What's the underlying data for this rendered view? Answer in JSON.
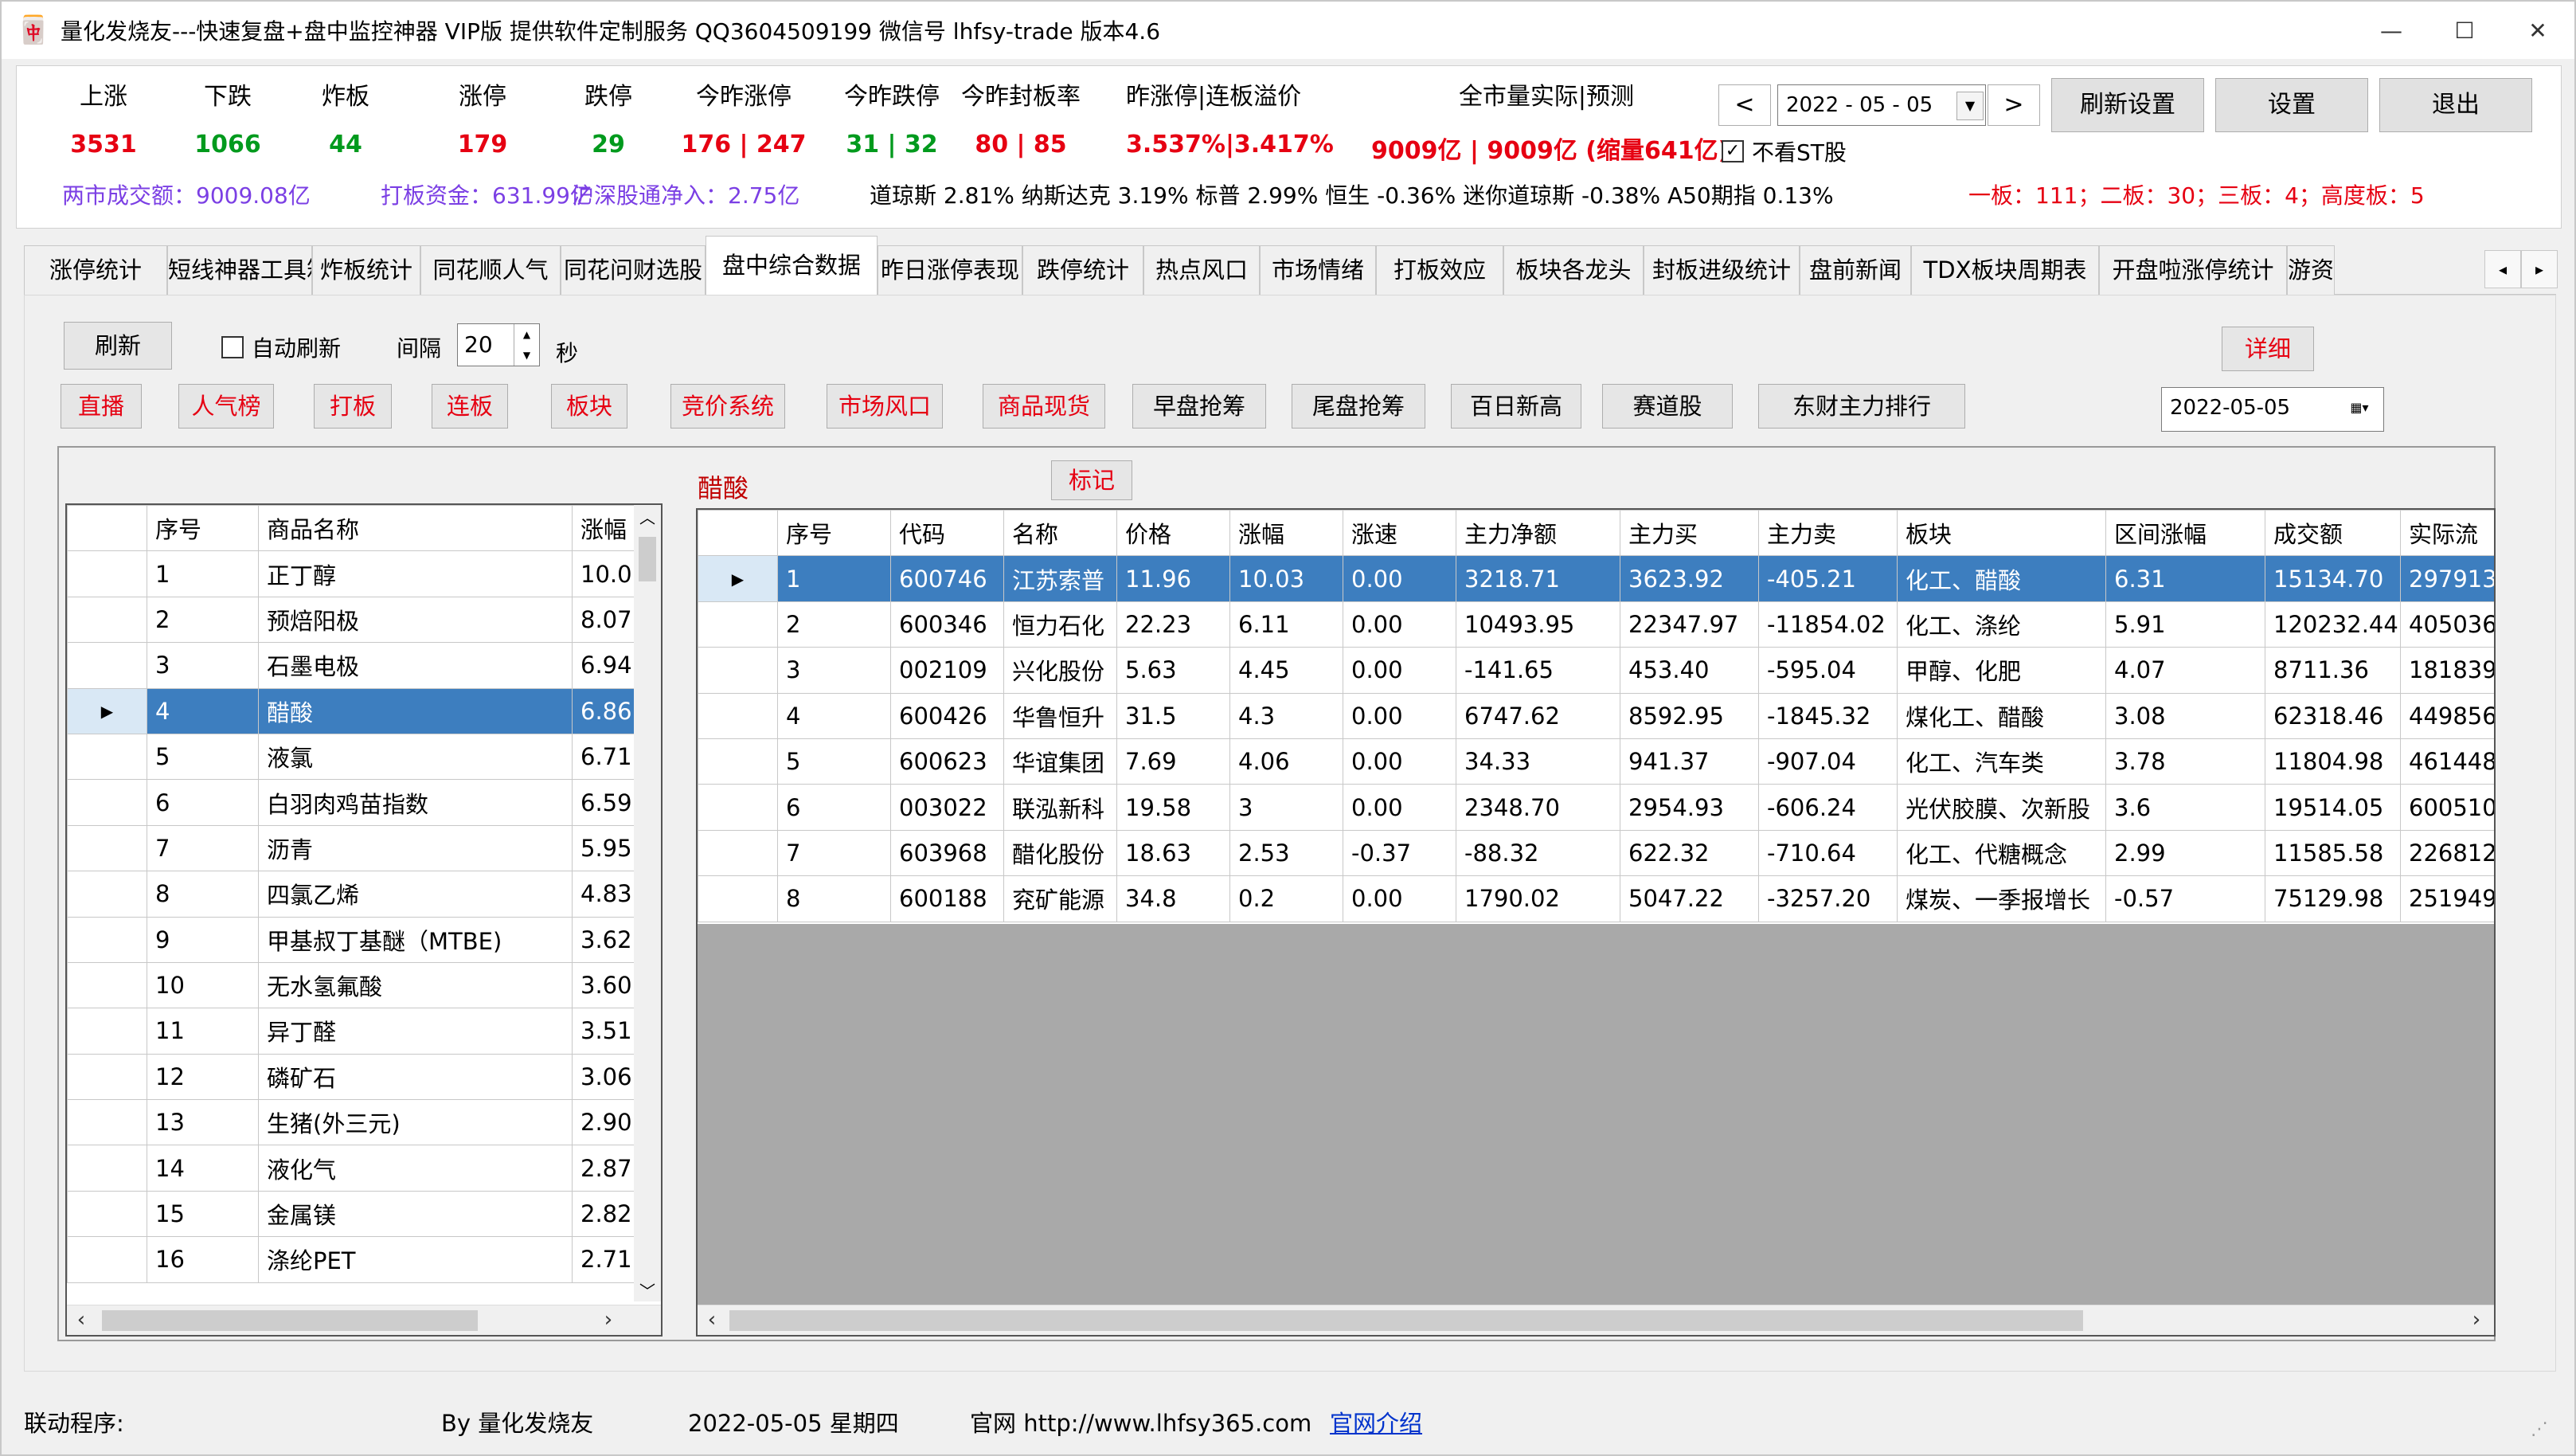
{
  "window": {
    "title": "量化发烧友---快速复盘+盘中监控神器 VIP版  提供软件定制服务 QQ3604509199 微信号 lhfsy-trade   版本4.6",
    "minimize": "—",
    "maximize": "☐",
    "close": "✕"
  },
  "stats": [
    {
      "label": "上涨",
      "value": "3531",
      "color": "red"
    },
    {
      "label": "下跌",
      "value": "1066",
      "color": "green"
    },
    {
      "label": "炸板",
      "value": "44",
      "color": "green"
    },
    {
      "label": "涨停",
      "value": "179",
      "color": "red"
    },
    {
      "label": "跌停",
      "value": "29",
      "color": "green"
    },
    {
      "label": "今昨涨停",
      "value": "176 | 247",
      "color": "red"
    },
    {
      "label": "今昨跌停",
      "value": "31 | 32",
      "color": "green"
    },
    {
      "label": "今昨封板率",
      "value": "80 | 85",
      "color": "red"
    },
    {
      "label": "昨涨停|连板溢价",
      "value": "3.537%|3.417%",
      "color": "red"
    },
    {
      "label": "全市量实际|预测",
      "value": "9009亿 | 9009亿 (缩量641亿)",
      "color": "red"
    }
  ],
  "date_picker": {
    "prev": "<",
    "value": "2022 - 05 - 05",
    "next": ">"
  },
  "buttons": {
    "refresh_settings": "刷新设置",
    "settings": "设置",
    "exit": "退出"
  },
  "hide_st": {
    "label": "不看ST股",
    "checked": "✓"
  },
  "info_line": {
    "turnover": "两市成交额：9009.08亿",
    "board_funds": "打板资金：631.99亿",
    "northbound": "沪深股通净入：2.75亿",
    "indices": "道琼斯 2.81%  纳斯达克 3.19%  标普 2.99%  恒生 -0.36%  迷你道琼斯 -0.38%  A50期指 0.13%",
    "boards": "一板：111；二板：30；三板：4；高度板：5"
  },
  "tabs": [
    "涨停统计",
    "短线神器工具箱",
    "炸板统计",
    "同花顺人气",
    "同花问财选股",
    "盘中综合数据",
    "昨日涨停表现",
    "跌停统计",
    "热点风口",
    "市场情绪",
    "打板效应",
    "板块各龙头",
    "封板进级统计",
    "盘前新闻",
    "TDX板块周期表",
    "开盘啦涨停统计",
    "游资"
  ],
  "active_tab": "盘中综合数据",
  "toolbar": {
    "refresh": "刷新",
    "auto_refresh": "自动刷新",
    "interval_label": "间隔",
    "interval_value": "20",
    "seconds": "秒",
    "detail": "详细",
    "date": "2022-05-05"
  },
  "category_buttons": [
    "直播",
    "人气榜",
    "打板",
    "连板",
    "板块",
    "竞价系统",
    "市场风口",
    "商品现货"
  ],
  "feature_buttons": [
    "早盘抢筹",
    "尾盘抢筹",
    "百日新高",
    "赛道股",
    "东财主力排行"
  ],
  "commodity_label": "醋酸",
  "mark_button": "标记",
  "left_table": {
    "headers": [
      "序号",
      "商品名称",
      "涨幅"
    ],
    "rows": [
      [
        "1",
        "正丁醇",
        "10.0"
      ],
      [
        "2",
        "预焙阳极",
        "8.07"
      ],
      [
        "3",
        "石墨电极",
        "6.94"
      ],
      [
        "4",
        "醋酸",
        "6.86"
      ],
      [
        "5",
        "液氯",
        "6.71"
      ],
      [
        "6",
        "白羽肉鸡苗指数",
        "6.59"
      ],
      [
        "7",
        "沥青",
        "5.95"
      ],
      [
        "8",
        "四氯乙烯",
        "4.83"
      ],
      [
        "9",
        "甲基叔丁基醚（MTBE)",
        "3.62"
      ],
      [
        "10",
        "无水氢氟酸",
        "3.60"
      ],
      [
        "11",
        "异丁醛",
        "3.51"
      ],
      [
        "12",
        "磷矿石",
        "3.06"
      ],
      [
        "13",
        "生猪(外三元)",
        "2.90"
      ],
      [
        "14",
        "液化气",
        "2.87"
      ],
      [
        "15",
        "金属镁",
        "2.82"
      ],
      [
        "16",
        "涤纶PET",
        "2.71"
      ]
    ],
    "selected_index": 3
  },
  "right_table": {
    "headers": [
      "序号",
      "代码",
      "名称",
      "价格",
      "涨幅",
      "涨速",
      "主力净额",
      "主力买",
      "主力卖",
      "板块",
      "区间涨幅",
      "成交额",
      "实际流"
    ],
    "rows": [
      [
        "1",
        "600746",
        "江苏索普",
        "11.96",
        "10.03",
        "0.00",
        "3218.71",
        "3623.92",
        "-405.21",
        "化工、醋酸",
        "6.31",
        "15134.70",
        "297913"
      ],
      [
        "2",
        "600346",
        "恒力石化",
        "22.23",
        "6.11",
        "0.00",
        "10493.95",
        "22347.97",
        "-11854.02",
        "化工、涤纶",
        "5.91",
        "120232.44",
        "405036"
      ],
      [
        "3",
        "002109",
        "兴化股份",
        "5.63",
        "4.45",
        "0.00",
        "-141.65",
        "453.40",
        "-595.04",
        "甲醇、化肥",
        "4.07",
        "8711.36",
        "181839"
      ],
      [
        "4",
        "600426",
        "华鲁恒升",
        "31.5",
        "4.3",
        "0.00",
        "6747.62",
        "8592.95",
        "-1845.32",
        "煤化工、醋酸",
        "3.08",
        "62318.46",
        "449856"
      ],
      [
        "5",
        "600623",
        "华谊集团",
        "7.69",
        "4.06",
        "0.00",
        "34.33",
        "941.37",
        "-907.04",
        "化工、汽车类",
        "3.78",
        "11804.98",
        "461448"
      ],
      [
        "6",
        "003022",
        "联泓新科",
        "19.58",
        "3",
        "0.00",
        "2348.70",
        "2954.93",
        "-606.24",
        "光伏胶膜、次新股",
        "3.6",
        "19514.05",
        "600510"
      ],
      [
        "7",
        "603968",
        "醋化股份",
        "18.63",
        "2.53",
        "-0.37",
        "-88.32",
        "622.32",
        "-710.64",
        "化工、代糖概念",
        "2.99",
        "11585.58",
        "226812"
      ],
      [
        "8",
        "600188",
        "兖矿能源",
        "34.8",
        "0.2",
        "0.00",
        "1790.02",
        "5047.22",
        "-3257.20",
        "煤炭、一季报增长",
        "-0.57",
        "75129.98",
        "251949"
      ]
    ],
    "selected_index": 0
  },
  "statusbar": {
    "linked": "联动程序:",
    "by": "By 量化发烧友",
    "date": "2022-05-05 星期四",
    "site": "官网 http://www.lhfsy365.com",
    "intro": "官网介绍"
  },
  "colors": {
    "red": "#e60012",
    "green": "#009a1d",
    "purple": "#7b3fe4",
    "selection": "#3d7ebf"
  }
}
